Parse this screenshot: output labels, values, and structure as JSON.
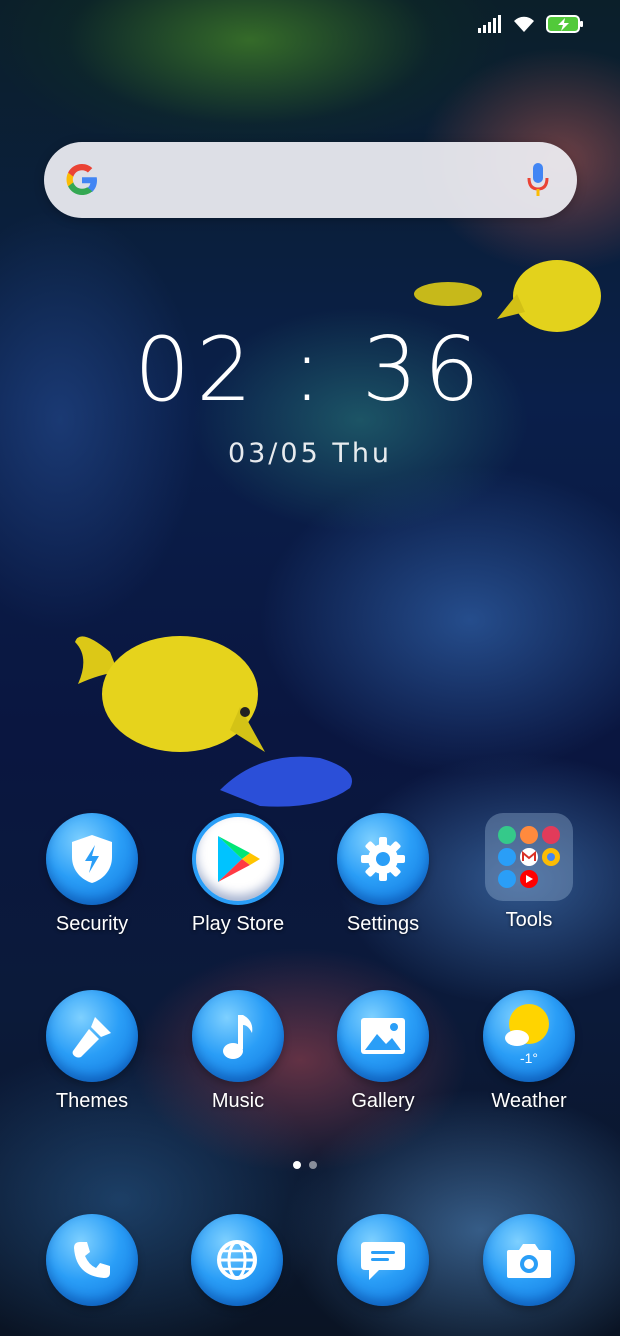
{
  "status_bar": {
    "icons": [
      "signal-icon",
      "wifi-icon",
      "battery-charging-icon"
    ]
  },
  "search_bar": {
    "logo": "google-icon",
    "mic": "mic-icon"
  },
  "clock": {
    "time": "02 : 36",
    "date": "03/05 Thu"
  },
  "apps_row1": [
    {
      "label": "Security",
      "icon": "shield-bolt-icon"
    },
    {
      "label": "Play Store",
      "icon": "play-store-icon"
    },
    {
      "label": "Settings",
      "icon": "gear-icon"
    },
    {
      "label": "Tools",
      "icon": "folder-icon"
    }
  ],
  "apps_row2": [
    {
      "label": "Themes",
      "icon": "paintbrush-icon"
    },
    {
      "label": "Music",
      "icon": "music-note-icon"
    },
    {
      "label": "Gallery",
      "icon": "image-icon"
    },
    {
      "label": "Weather",
      "icon": "weather-icon"
    }
  ],
  "weather": {
    "temp": "-1°"
  },
  "page_indicator": {
    "pages": 2,
    "current": 1
  },
  "dock": [
    {
      "icon": "phone-icon"
    },
    {
      "icon": "globe-icon"
    },
    {
      "icon": "message-icon"
    },
    {
      "icon": "camera-icon"
    }
  ],
  "colors": {
    "icon_blue": "#2a9ef7",
    "fish_yellow": "#e8d41a"
  }
}
